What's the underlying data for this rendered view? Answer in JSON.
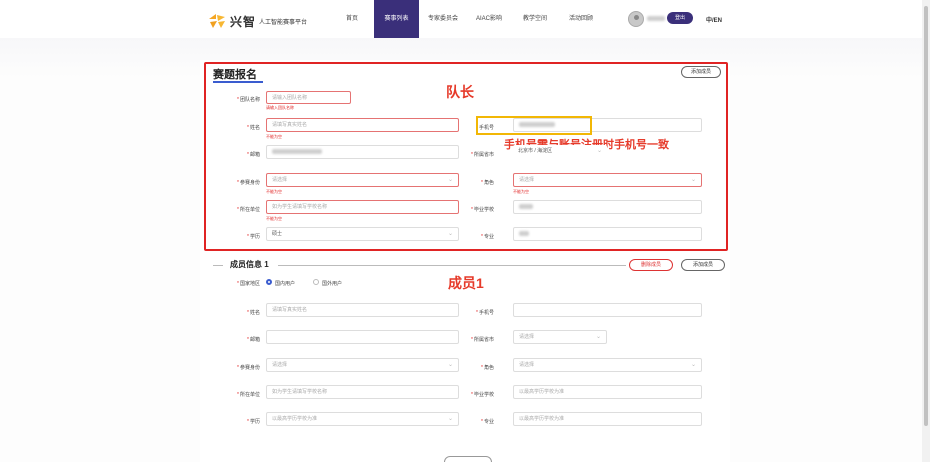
{
  "header": {
    "logo_main": "兴智",
    "logo_sub": "人工智能赛事平台",
    "nav": [
      {
        "label": "首页",
        "active": false
      },
      {
        "label": "赛事列表",
        "active": true
      },
      {
        "label": "专家委员会",
        "active": false
      },
      {
        "label": "AIAC影响",
        "active": false
      },
      {
        "label": "教学空间",
        "active": false
      },
      {
        "label": "活动回顾",
        "active": false
      }
    ],
    "logout_label": "登出",
    "lang_label": "中/EN"
  },
  "captain_section": {
    "title": "赛题报名",
    "add_member_label": "添加成员",
    "annotation": "队长",
    "phone_annotation": "手机号需与账号注册时手机号一致",
    "fields": {
      "team_name": {
        "label": "团队名称",
        "placeholder": "请输入团队名称",
        "error": "请输入团队名称"
      },
      "name": {
        "label": "姓名",
        "placeholder": "请填写真实姓名",
        "error": "不能为空"
      },
      "phone": {
        "label": "手机号"
      },
      "email": {
        "label": "邮箱"
      },
      "region": {
        "label": "所属省市",
        "value": "北京市 / 海淀区"
      },
      "identity": {
        "label": "参赛身份",
        "placeholder": "请选择",
        "error": "不能为空"
      },
      "role": {
        "label": "角色",
        "placeholder": "请选择",
        "error": "不能为空"
      },
      "org": {
        "label": "所在单位",
        "placeholder": "如为学生请填写学校名称",
        "error": "不能为空"
      },
      "school": {
        "label": "毕业学校"
      },
      "degree": {
        "label": "学历",
        "value": "硕士"
      },
      "major": {
        "label": "专业"
      }
    }
  },
  "member_section": {
    "title": "成员信息 1",
    "delete_label": "删除成员",
    "add_label": "添加成员",
    "annotation": "成员1",
    "region_label": "国家地区",
    "radio_domestic": "国内用户",
    "radio_foreign": "国外用户",
    "fields": {
      "name": {
        "label": "姓名",
        "placeholder": "请填写真实姓名"
      },
      "phone": {
        "label": "手机号"
      },
      "email": {
        "label": "邮箱"
      },
      "region": {
        "label": "所属省市",
        "placeholder": "请选择"
      },
      "identity": {
        "label": "参赛身份",
        "placeholder": "请选择"
      },
      "role": {
        "label": "角色",
        "placeholder": "请选择"
      },
      "org": {
        "label": "所在单位",
        "placeholder": "如为学生请填写学校名称"
      },
      "school": {
        "label": "毕业学校",
        "placeholder": "以最高学历学校为准"
      },
      "degree": {
        "label": "学历",
        "placeholder": "以最高学历学校为准"
      },
      "major": {
        "label": "专业",
        "placeholder": "以最高学历学校为准"
      }
    }
  },
  "colors": {
    "accent": "#3a2f7a",
    "annotation_red": "#e63a2a",
    "highlight_yellow": "#f2b705"
  }
}
